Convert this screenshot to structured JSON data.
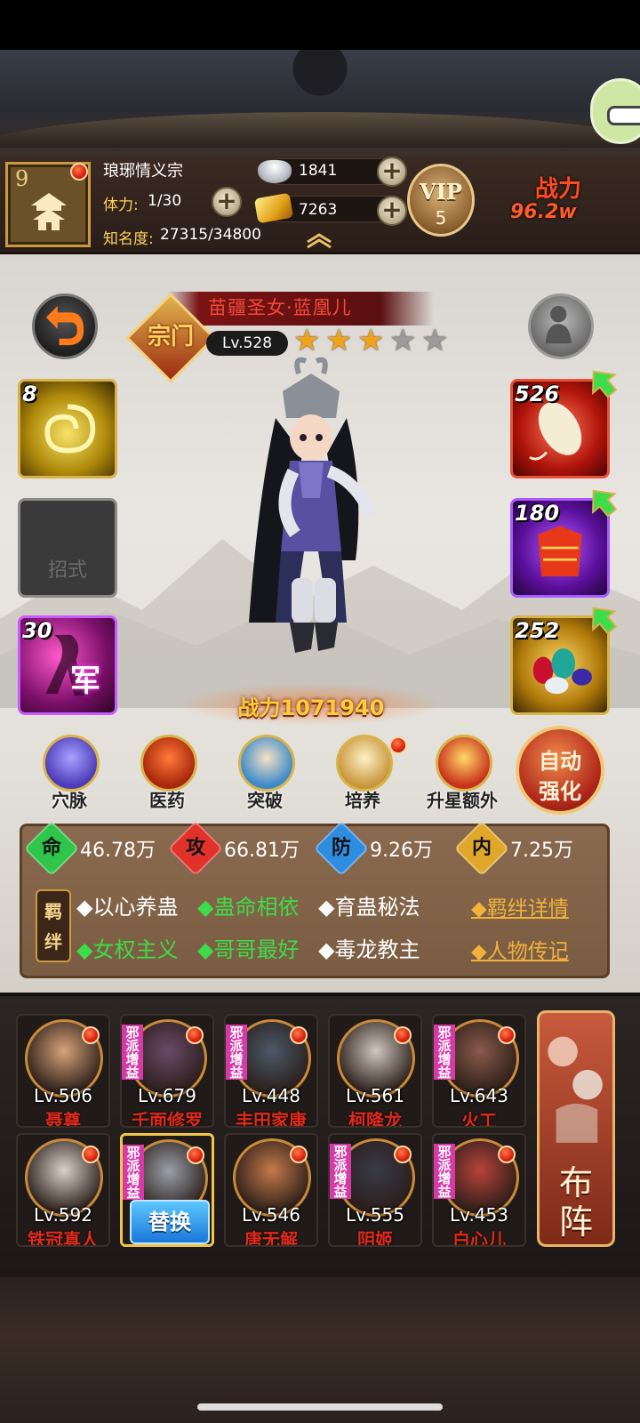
{
  "header": {
    "player_level": "9",
    "guild_name": "琅琊情义宗",
    "stamina_label": "体力:",
    "stamina_value": "1/30",
    "fame_label": "知名度:",
    "fame_value": "27315/34800",
    "silver": "1841",
    "gold": "7263",
    "vip_label": "VIP",
    "vip_level": "5",
    "power_label": "战力",
    "power_value": "96.2w"
  },
  "hero": {
    "name": "苗疆圣女·蓝凰儿",
    "emblem": "宗门",
    "level": "Lv.528",
    "stars_filled": 3,
    "stars_total": 5,
    "battle_power": "战力1071940"
  },
  "slots": {
    "left": [
      {
        "num": "8",
        "label": ""
      },
      {
        "num": "",
        "label": "招式"
      },
      {
        "num": "30",
        "label": "",
        "glyph": "军"
      }
    ],
    "right": [
      {
        "num": "526"
      },
      {
        "num": "180"
      },
      {
        "num": "252"
      }
    ]
  },
  "menu": [
    {
      "label": "穴脉",
      "icon": "meridian-icon"
    },
    {
      "label": "医药",
      "icon": "medicine-icon"
    },
    {
      "label": "突破",
      "icon": "breakthrough-icon"
    },
    {
      "label": "培养",
      "icon": "cultivate-icon"
    },
    {
      "label": "升星额外",
      "icon": "star-up-icon"
    }
  ],
  "auto_button": {
    "line1": "自动",
    "line2": "强化"
  },
  "stats": [
    {
      "glyph": "命",
      "value": "46.78万",
      "color": "#2fc44a"
    },
    {
      "glyph": "攻",
      "value": "66.81万",
      "color": "#e0312a"
    },
    {
      "glyph": "防",
      "value": "9.26万",
      "color": "#2f8de0"
    },
    {
      "glyph": "内",
      "value": "7.25万",
      "color": "#e0a72a"
    }
  ],
  "bonds": {
    "tag": "羁绊",
    "row1": [
      {
        "text": "◆以心养蛊",
        "active": false
      },
      {
        "text": "◆蛊命相依",
        "active": true
      },
      {
        "text": "◆育蛊秘法",
        "active": false
      }
    ],
    "row2": [
      {
        "text": "◆女权主义",
        "active": true
      },
      {
        "text": "◆哥哥最好",
        "active": true
      },
      {
        "text": "◆毒龙教主",
        "active": false
      }
    ],
    "detail_link": "◆羁绊详情",
    "bio_link": "◆人物传记"
  },
  "team": [
    {
      "level": "Lv.506",
      "name": "聂尊",
      "tag": ""
    },
    {
      "level": "Lv.679",
      "name": "千面修罗",
      "tag": "邪派增益"
    },
    {
      "level": "Lv.448",
      "name": "丰田家康",
      "tag": "邪派增益"
    },
    {
      "level": "Lv.561",
      "name": "柯降龙",
      "tag": ""
    },
    {
      "level": "Lv.643",
      "name": "火工",
      "tag": "邪派增益"
    },
    {
      "level": "Lv.592",
      "name": "铁冠真人",
      "tag": ""
    },
    {
      "level": "",
      "name": "",
      "tag": "邪派增益",
      "replace": "替换"
    },
    {
      "level": "Lv.546",
      "name": "唐无解",
      "tag": ""
    },
    {
      "level": "Lv.555",
      "name": "阴姬",
      "tag": "邪派增益"
    },
    {
      "level": "Lv.453",
      "name": "白心儿",
      "tag": "邪派增益"
    }
  ],
  "formation": {
    "line1": "布",
    "line2": "阵"
  }
}
